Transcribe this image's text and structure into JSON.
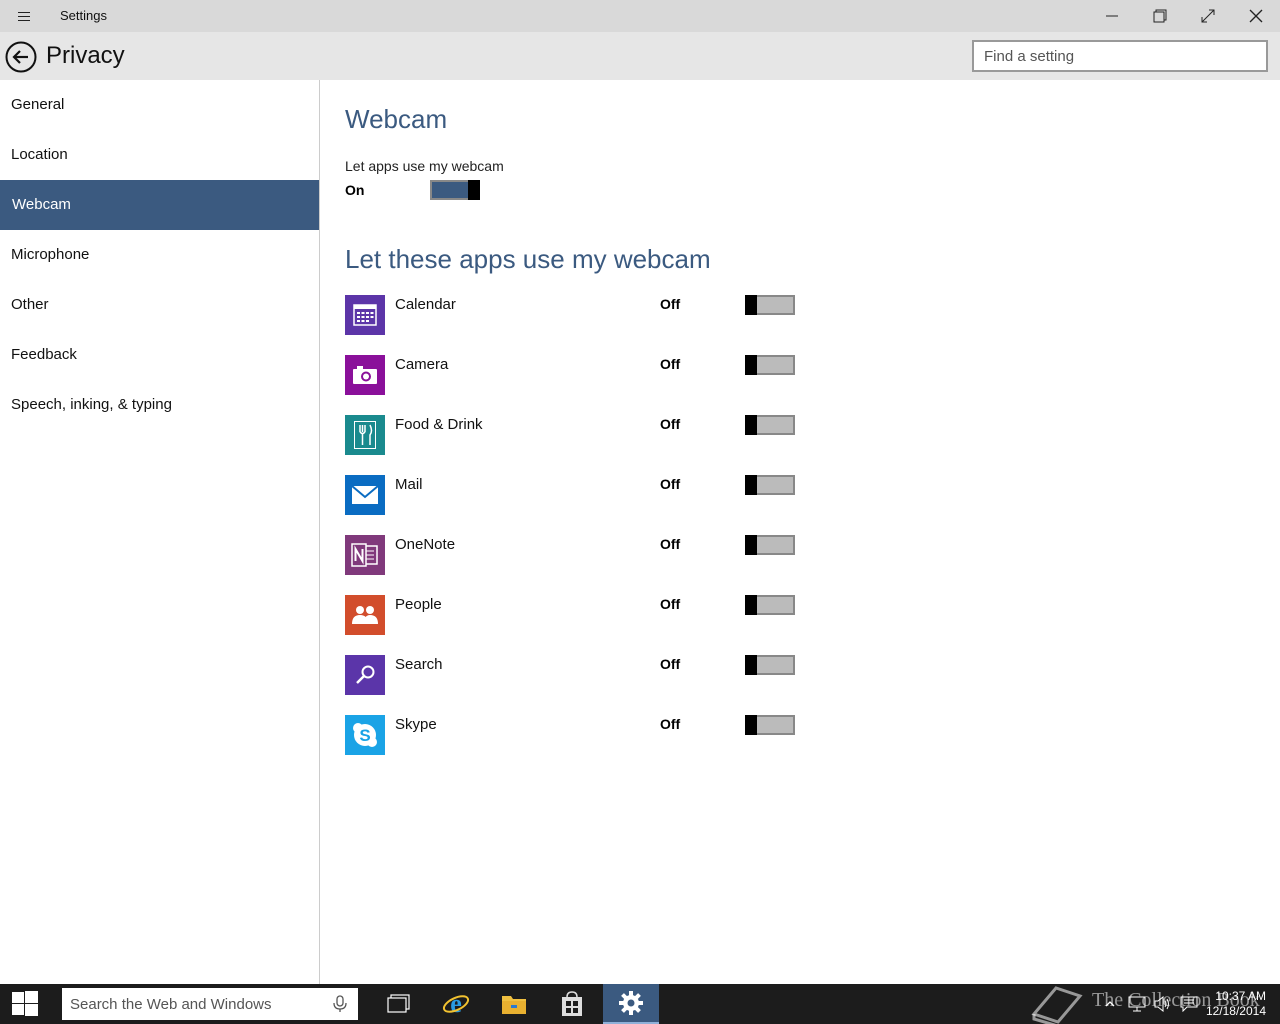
{
  "window": {
    "title": "Settings"
  },
  "header": {
    "title": "Privacy",
    "search_placeholder": "Find a setting"
  },
  "sidebar": {
    "items": [
      {
        "label": "General"
      },
      {
        "label": "Location"
      },
      {
        "label": "Webcam",
        "selected": true
      },
      {
        "label": "Microphone"
      },
      {
        "label": "Other"
      },
      {
        "label": "Feedback"
      },
      {
        "label": "Speech, inking, & typing"
      }
    ]
  },
  "main": {
    "heading": "Webcam",
    "master_label": "Let apps use my webcam",
    "master_state": "On",
    "master_on": true,
    "apps_heading": "Let these apps use my webcam",
    "apps": [
      {
        "name": "Calendar",
        "state": "Off",
        "icon": "calendar-icon",
        "color": "#5c35a8"
      },
      {
        "name": "Camera",
        "state": "Off",
        "icon": "camera-icon",
        "color": "#8a109a"
      },
      {
        "name": "Food & Drink",
        "state": "Off",
        "icon": "food-drink-icon",
        "color": "#1a8a8e"
      },
      {
        "name": "Mail",
        "state": "Off",
        "icon": "mail-icon",
        "color": "#0a6cc2"
      },
      {
        "name": "OneNote",
        "state": "Off",
        "icon": "onenote-icon",
        "color": "#80397b"
      },
      {
        "name": "People",
        "state": "Off",
        "icon": "people-icon",
        "color": "#d24d2c"
      },
      {
        "name": "Search",
        "state": "Off",
        "icon": "search-app-icon",
        "color": "#5b35a9"
      },
      {
        "name": "Skype",
        "state": "Off",
        "icon": "skype-icon",
        "color": "#1aa3e6"
      }
    ]
  },
  "taskbar": {
    "search_placeholder": "Search the Web and Windows",
    "clock_time": "10:37 AM",
    "clock_date": "12/18/2014",
    "watermark": "The Collection Book"
  },
  "colors": {
    "accent": "#3b5a80",
    "titlebar": "#d9d9d9",
    "header": "#e6e6e6",
    "taskbar": "#1c1c1c"
  }
}
